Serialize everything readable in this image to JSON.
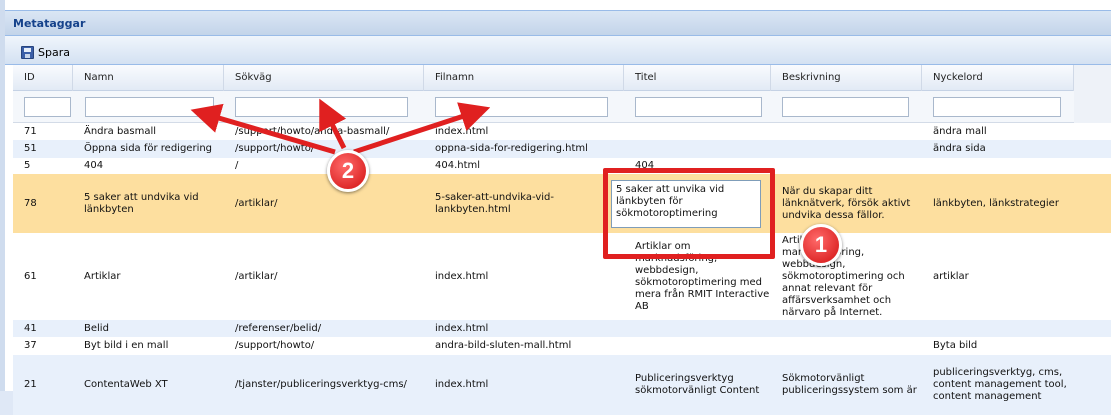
{
  "panel": {
    "title": "Metataggar"
  },
  "toolbar": {
    "save_label": "Spara",
    "save_icon": "floppy-disk-icon"
  },
  "columns": [
    "ID",
    "Namn",
    "Sökväg",
    "Filnamn",
    "Titel",
    "Beskrivning",
    "Nyckelord"
  ],
  "filters": {
    "id": "",
    "namn": "",
    "sokvag": "",
    "filnamn": "",
    "titel": "",
    "beskrivning": "",
    "nyckelord": ""
  },
  "rows": [
    {
      "id": "71",
      "namn": "Ändra basmall",
      "sokvag": "/support/howto/andra-basmall/",
      "filnamn": "index.html",
      "titel": "",
      "beskrivning": "",
      "nyckelord": "ändra mall"
    },
    {
      "id": "51",
      "namn": "Öppna sida för redigering",
      "sokvag": "/support/howto/",
      "filnamn": "oppna-sida-for-redigering.html",
      "titel": "",
      "beskrivning": "",
      "nyckelord": "ändra sida"
    },
    {
      "id": "5",
      "namn": "404",
      "sokvag": "/",
      "filnamn": "404.html",
      "titel": "404",
      "beskrivning": "",
      "nyckelord": ""
    },
    {
      "id": "78",
      "namn": "5 saker att undvika vid länkbyten",
      "sokvag": "/artiklar/",
      "filnamn": "5-saker-att-undvika-vid-lankbyten.html",
      "titel": "5 saker att unvika vid länkbyten för sökmotoroptimering",
      "beskrivning": "När du skapar ditt länknätverk, försök aktivt undvika dessa fällor.",
      "nyckelord": "länkbyten, länkstrategier"
    },
    {
      "id": "61",
      "namn": "Artiklar",
      "sokvag": "/artiklar/",
      "filnamn": "index.html",
      "titel": "Artiklar om marknadsföring, webbdesign, sökmotoroptimering med mera från RMIT Interactive AB",
      "beskrivning": "Artiklar om marknadsföring, webbdesign, sökmotoroptimering och annat relevant för affärsverksamhet och närvaro på Internet.",
      "nyckelord": "artiklar"
    },
    {
      "id": "41",
      "namn": "Belid",
      "sokvag": "/referenser/belid/",
      "filnamn": "index.html",
      "titel": "",
      "beskrivning": "",
      "nyckelord": ""
    },
    {
      "id": "37",
      "namn": "Byt bild i en mall",
      "sokvag": "/support/howto/",
      "filnamn": "andra-bild-sluten-mall.html",
      "titel": "",
      "beskrivning": "",
      "nyckelord": "Byta bild"
    },
    {
      "id": "21",
      "namn": "ContentaWeb XT",
      "sokvag": "/tjanster/publiceringsverktyg-cms/",
      "filnamn": "index.html",
      "titel": "Publiceringsverktyg sökmotorvänligt Content",
      "beskrivning": "Sökmotorvänligt publiceringssystem som är",
      "nyckelord": "publiceringsverktyg, cms, content management tool, content management"
    }
  ],
  "annotations": {
    "callout_1": "1",
    "callout_2": "2"
  },
  "colors": {
    "annotation": "#e02020",
    "selected_row": "#fddf9f",
    "alt_row": "#e8f0fb",
    "title_text": "#15428b"
  }
}
